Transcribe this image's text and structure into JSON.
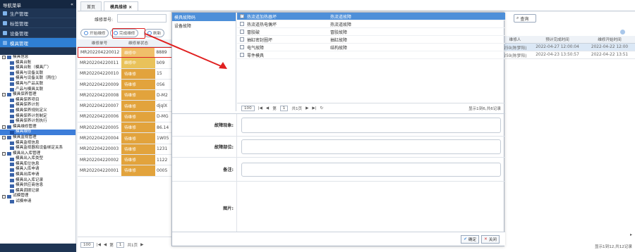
{
  "nav": {
    "title": "导航菜单",
    "collapse": "«",
    "items": [
      {
        "label": "生产管理"
      },
      {
        "label": "标签管理"
      },
      {
        "label": "设备管理"
      },
      {
        "label": "模具管理"
      }
    ]
  },
  "tree": [
    {
      "level": 0,
      "toggle": "-",
      "label": "模具信息"
    },
    {
      "level": 1,
      "label": "模具台账"
    },
    {
      "level": 1,
      "label": "模具台账（模具厂）"
    },
    {
      "level": 1,
      "label": "模具与设备关联"
    },
    {
      "level": 1,
      "label": "模具与设备关联（两位）"
    },
    {
      "level": 1,
      "label": "模具与产品关联"
    },
    {
      "level": 1,
      "label": "产品与模具关联"
    },
    {
      "level": 0,
      "toggle": "-",
      "label": "模具保养管理"
    },
    {
      "level": 1,
      "label": "模具保养项目"
    },
    {
      "level": 1,
      "label": "模具保养计划"
    },
    {
      "level": 1,
      "label": "模具保养规则定义"
    },
    {
      "level": 1,
      "label": "模具保养计划制定"
    },
    {
      "level": 1,
      "label": "模具保养计划执行"
    },
    {
      "level": 0,
      "toggle": "-",
      "label": "模具维修管理"
    },
    {
      "level": 1,
      "label": "模具维修",
      "selected": true
    },
    {
      "level": 0,
      "toggle": "-",
      "label": "模具监视管理"
    },
    {
      "level": 1,
      "label": "模具监视信息"
    },
    {
      "level": 1,
      "label": "模具监视器和设备绑定关系"
    },
    {
      "level": 0,
      "toggle": "-",
      "label": "模具出入库管理"
    },
    {
      "level": 1,
      "label": "模具出入库类型"
    },
    {
      "level": 1,
      "label": "模具库位信息"
    },
    {
      "level": 1,
      "label": "模具入库申请"
    },
    {
      "level": 1,
      "label": "模具出库申请"
    },
    {
      "level": 1,
      "label": "模具出入库记录"
    },
    {
      "level": 1,
      "label": "模具供应商信息"
    },
    {
      "level": 1,
      "label": "模具调拨记录"
    },
    {
      "level": 0,
      "toggle": "-",
      "label": "试模管理"
    },
    {
      "level": 1,
      "label": "试模申请"
    }
  ],
  "tabs": {
    "home": "首页",
    "active": "模具维修",
    "close": "×"
  },
  "toolbar": {
    "repair_no_label": "维修单号:",
    "start_label": "开始维修",
    "complete_label": "完成维修",
    "refresh_label": "刷新",
    "search_label": "查询"
  },
  "grid": {
    "headers": [
      "维修单号",
      "维修单状态",
      ""
    ],
    "rows": [
      {
        "no": "MR202204220012",
        "status": "维修中",
        "extra": "8889"
      },
      {
        "no": "MR202204220011",
        "status": "维修中",
        "extra": "b09"
      },
      {
        "no": "MR202204220010",
        "status": "待维修",
        "extra": "15"
      },
      {
        "no": "MR202204220009",
        "status": "待维修",
        "extra": "056"
      },
      {
        "no": "MR202204220008",
        "status": "待维修",
        "extra": "D-M2"
      },
      {
        "no": "MR202204220007",
        "status": "待维修",
        "extra": "djqlX"
      },
      {
        "no": "MR202204220006",
        "status": "待维修",
        "extra": "D-MG"
      },
      {
        "no": "MR202204220005",
        "status": "待维修",
        "extra": "86.14"
      },
      {
        "no": "MR202204220004",
        "status": "待维修",
        "extra": "1W05"
      },
      {
        "no": "MR202204220003",
        "status": "待维修",
        "extra": "1231"
      },
      {
        "no": "MR202204220002",
        "status": "待维修",
        "extra": "1122"
      },
      {
        "no": "MR202204220001",
        "status": "待维修",
        "extra": "0005"
      }
    ],
    "pager": {
      "size": "100",
      "first": "|◀",
      "prev": "◀",
      "page_label": "第",
      "page": "1",
      "total": "共1页",
      "next": "▶"
    }
  },
  "right_grid": {
    "headers": [
      "维修人",
      "预计完成时间",
      "维修开始时间"
    ],
    "rows": [
      {
        "person": "259(陈梦阳)",
        "plan": "2022-04-27 12:00:04",
        "start": "2022-04-22 12:00"
      },
      {
        "person": "259(陈梦阳)",
        "plan": "2022-04-23 13:50:57",
        "start": "2022-04-22 13:51"
      }
    ],
    "pager_info": "显示1到12,共12记录",
    "scroll_arrow": "▸"
  },
  "popup": {
    "categories": [
      {
        "label": "模具故障码",
        "selected": true
      },
      {
        "label": "设备故障",
        "selected": false
      }
    ],
    "faults": [
      {
        "name": "热流道加热器坏",
        "type": "热流道故障",
        "checked": true
      },
      {
        "name": "热流道热电偶坏",
        "type": "热流道故障",
        "checked": false
      },
      {
        "name": "冒胶破",
        "type": "冒胶故障",
        "checked": false
      },
      {
        "name": "抽缸密封圈坏",
        "type": "抽缸故障",
        "checked": false
      },
      {
        "name": "电气故障",
        "type": "结构故障",
        "checked": false
      },
      {
        "name": "零件模具",
        "type": "",
        "checked": false
      }
    ],
    "pager": {
      "size": "100",
      "page_label": "第",
      "page": "1",
      "total": "共1页",
      "info": "显示1到6,共6记录"
    },
    "form": [
      {
        "label": "故障现象:"
      },
      {
        "label": "故障部位:"
      },
      {
        "label": "备注:"
      },
      {
        "label": "图片:"
      }
    ],
    "confirm_label": "确定",
    "close_label": "关闭"
  }
}
